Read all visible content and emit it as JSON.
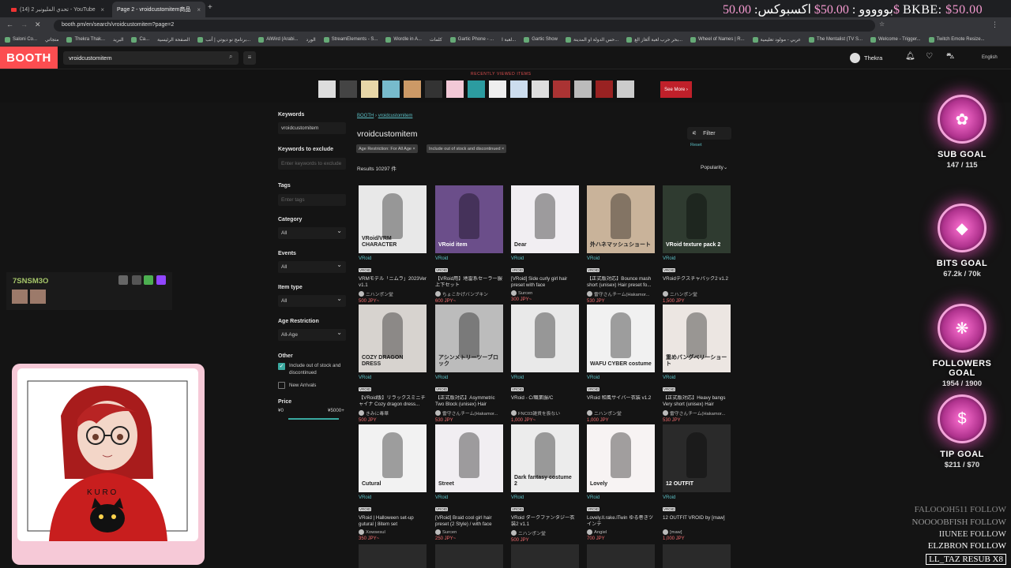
{
  "browser": {
    "tabs": [
      {
        "label": "(14) تحدي المليونير 2 - YouTube",
        "active": false
      },
      {
        "label": "Page 2 - vroidcustomitem商品",
        "active": true
      }
    ],
    "url": "booth.pm/en/search/vroidcustomitem?page=2",
    "bookmarks": [
      "Saloni Co...",
      "متجاتي",
      "Thekra Thak...",
      "البريد",
      "Ca...",
      "الصفحة الرئيسية",
      "برنامج نو ديوتي | أنب...",
      "AlWird (Arabi...",
      "الورد",
      "StreamElements - S...",
      "Wordle in A...",
      "كلمات",
      "Gartic Phone - ...",
      "لعبة ا...",
      "Gartic Show",
      "حس الدولة او المدينة...",
      "بحر حرب لعبة ألغاز الع...",
      "Wheel of Names | R...",
      "عربي - مولود تعليمية",
      "The Mentalist (TV S...",
      "Welcome - Trigger...",
      "Twitch Emote Resize..."
    ]
  },
  "overlay": {
    "donations_a": "بووووو : ",
    "donations_b": "50.00$",
    "donations_c": " اكسبوكس: ",
    "donations_d": "50.00$",
    "donations_e": " BKBE: ",
    "donations_f": "$50.00",
    "user_name": "7SNSM3O",
    "goals": [
      {
        "name": "SUB GOAL",
        "value": "147 / 115",
        "icon": "✿"
      },
      {
        "name": "BITS GOAL",
        "value": "67.2k / 70k",
        "icon": "◆"
      },
      {
        "name": "FOLLOWERS GOAL",
        "value": "1954 / 1900",
        "icon": "❋"
      },
      {
        "name": "TIP GOAL",
        "value": "$211 / $70",
        "icon": "$"
      }
    ],
    "events": [
      {
        "text": "FALOOOH511 FOLLOW",
        "color": "#888"
      },
      {
        "text": "NOOOOBFISH FOLLOW",
        "color": "#999"
      },
      {
        "text": "IIUNEE FOLLOW",
        "color": "#ddd"
      },
      {
        "text": "ELZBRON FOLLOW",
        "color": "#fff"
      },
      {
        "text": "LL_TAZ RESUB X8",
        "color": "#fff"
      }
    ]
  },
  "booth": {
    "logo": "BOOTH",
    "search_value": "vroidcustomitem",
    "user": "Thekra",
    "language": "English",
    "recent_title": "RECENTLY VIEWED ITEMS",
    "see_more": "See More ›",
    "breadcrumb": [
      "BOOTH",
      "vroidcustomitem"
    ],
    "heading": "vroidcustomitem",
    "filter_label": "Filter",
    "reset_label": "Reset",
    "chips": [
      "Age Restriction: For All Age",
      "Include out of stock and discontinued"
    ],
    "results": "Results 10297 件",
    "sort": "Popularity",
    "sidebar": {
      "keywords_label": "Keywords",
      "keywords_value": "vroidcustomitem",
      "exclude_label": "Keywords to exclude",
      "exclude_placeholder": "Enter keywords to exclude",
      "tags_label": "Tags",
      "tags_placeholder": "Enter tags",
      "category_label": "Category",
      "category_value": "All",
      "events_label": "Events",
      "events_value": "All",
      "itemtype_label": "Item type",
      "itemtype_value": "All",
      "age_label": "Age Restriction",
      "age_value": "All-Age",
      "other_label": "Other",
      "other_opt1": "Include out of stock and discontinued",
      "other_opt2": "New Arrivals",
      "price_label": "Price",
      "price_min": "¥0",
      "price_max": "¥5000+"
    },
    "items": [
      {
        "cat": "VRoid",
        "title": "VRMモデル「ニムラ」2023Ver v1.1",
        "shop": "ニハンポン堂",
        "price": "500 JPY~",
        "bg": "#e8e8e8",
        "text": "VRoid/VRM CHARACTER"
      },
      {
        "cat": "VRoid",
        "title": "【VRoid用】地雷系セーラー服上下セット",
        "shop": "ちょこかげバンブキン",
        "price": "600 JPY~",
        "bg": "#6b4e8a",
        "text": "VRoid item"
      },
      {
        "cat": "VRoid",
        "title": "[VRoid] Side curly girl hair preset with face",
        "shop": "Surcen",
        "price": "300 JPY~",
        "bg": "#f1eef2",
        "text": "Dear"
      },
      {
        "cat": "VRoid",
        "title": "【正式版対応】Bounce mash short (unisex) Hair preset fo...",
        "shop": "雷守さんチーム(Hakamor...",
        "price": "530 JPY",
        "bg": "#c9b39a",
        "text": "外ハネマッシュショート"
      },
      {
        "cat": "VRoid",
        "title": "VRoidテクスチャパック2 v1.2",
        "shop": "ニハンポン堂",
        "price": "1,500 JPY",
        "bg": "#2f3b30",
        "text": "VRoid texture pack 2"
      },
      {
        "cat": "VRoid",
        "title": "【VRoid版】リラックスミニチャイナ Cozy dragon dress...",
        "shop": "きみに毒華",
        "price": "500 JPY",
        "bg": "#d7d3cf",
        "text": "COZY DRAGON DRESS"
      },
      {
        "cat": "VRoid",
        "title": "【正式版対応】Asymmetric Two Block (unisex) Hair Preset...",
        "shop": "雷守さんチーム(Hakamor...",
        "price": "530 JPY",
        "bg": "#bcbcbc",
        "text": "アシンメトリーツーブロック"
      },
      {
        "cat": "VRoid",
        "title": "VRoid - C/職業服/C",
        "shop": "FNC03雑貨を扱ない",
        "price": "1,000 JPY~",
        "bg": "#e9e9e9",
        "text": ""
      },
      {
        "cat": "VRoid",
        "title": "VRoid 和風サイバー衣装 v1.2",
        "shop": "ニハンポン堂",
        "price": "1,000 JPY",
        "bg": "#f1f1f1",
        "text": "WAFU CYBER costume"
      },
      {
        "cat": "VRoid",
        "title": "【正式版対応】Heavy bangs Very short (unisex) Hair Preset...",
        "shop": "雷守さんチーム(Hakamor...",
        "price": "530 JPY",
        "bg": "#ece6e2",
        "text": "重めバングベリーショート"
      },
      {
        "cat": "VRoid",
        "title": "VRoid | Halloween set-up gutural | 8item set",
        "shop": "Xowsesul",
        "price": "350 JPY~",
        "bg": "#f2f2f2",
        "text": "Cutural"
      },
      {
        "cat": "VRoid",
        "title": "[VRoid] Braid cool girl hair preset (2 Style) / with face",
        "shop": "Surcen",
        "price": "250 JPY~",
        "bg": "#f1eef2",
        "text": "Street"
      },
      {
        "cat": "VRoid",
        "title": "VRoid ダークファンタジー衣装2 v1.1",
        "shop": "ニハンポン堂",
        "price": "500 JPY",
        "bg": "#ececec",
        "text": "Dark fantasy costume 2"
      },
      {
        "cat": "VRoid",
        "title": "Lovely.ll.rake.lTwin ゆる巻きツインテ",
        "shop": "Angiel",
        "price": "700 JPY",
        "bg": "#f7f3f3",
        "text": "Lovely"
      },
      {
        "cat": "VRoid",
        "title": "12 OUTFIT VROID by [maw]",
        "shop": "[maw]",
        "price": "1,000 JPY",
        "bg": "#2a2a2a",
        "text": "12 OUTFIT"
      }
    ]
  }
}
